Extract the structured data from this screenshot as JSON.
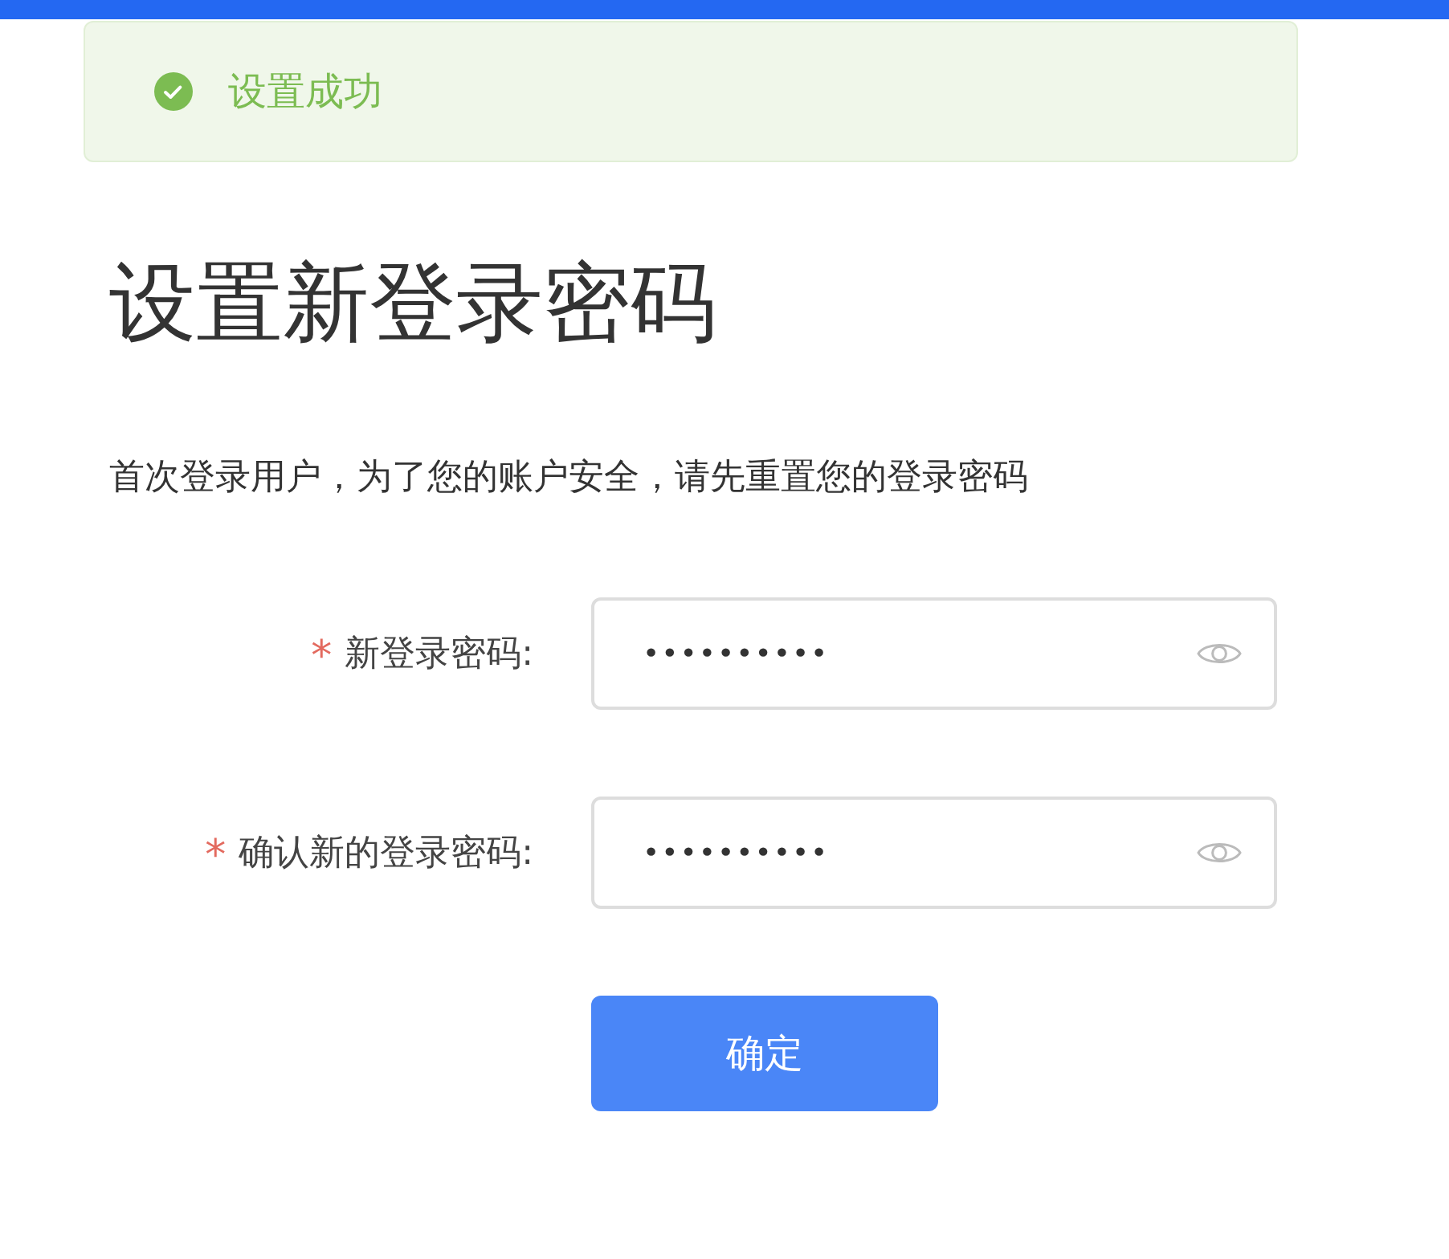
{
  "toast": {
    "kind": "success",
    "message": "设置成功"
  },
  "title": "设置新登录密码",
  "description": "首次登录用户，为了您的账户安全，请先重置您的登录密码",
  "fields": [
    {
      "required_mark": "*",
      "label": "新登录密码:",
      "required": true,
      "value": "••••••••••"
    },
    {
      "required_mark": "*",
      "label": "确认新的登录密码:",
      "required": true,
      "value": "••••••••••"
    }
  ],
  "submit": "确定"
}
